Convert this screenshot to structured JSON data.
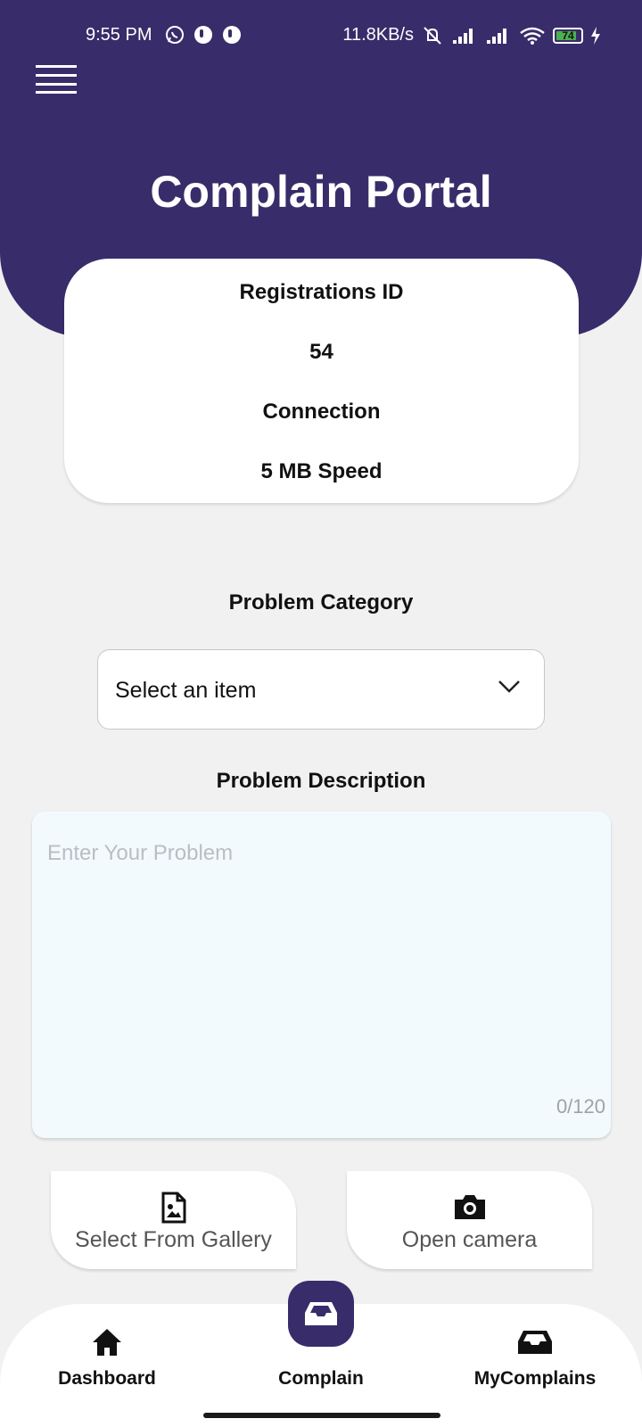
{
  "status_bar": {
    "time": "9:55 PM",
    "network_speed": "11.8KB/s",
    "battery_level": "74"
  },
  "header": {
    "title": "Complain Portal"
  },
  "info_card": {
    "registration_label": "Registrations ID",
    "registration_value": "54",
    "connection_label": "Connection",
    "connection_value": "5 MB Speed"
  },
  "form": {
    "category_label": "Problem Category",
    "category_value": "Select an item",
    "description_label": "Problem Description",
    "description_placeholder": "Enter Your Problem",
    "description_counter": "0/120"
  },
  "actions": {
    "gallery_label": "Select From Gallery",
    "camera_label": "Open camera"
  },
  "bottom_nav": {
    "items": [
      {
        "label": "Dashboard",
        "icon": "home-icon"
      },
      {
        "label": "Complain",
        "icon": "inbox-icon",
        "active": true
      },
      {
        "label": "MyComplains",
        "icon": "inbox-icon"
      }
    ]
  },
  "colors": {
    "primary": "#382d6a",
    "background": "#f1f1f1",
    "textarea_bg": "#f3fafe"
  }
}
